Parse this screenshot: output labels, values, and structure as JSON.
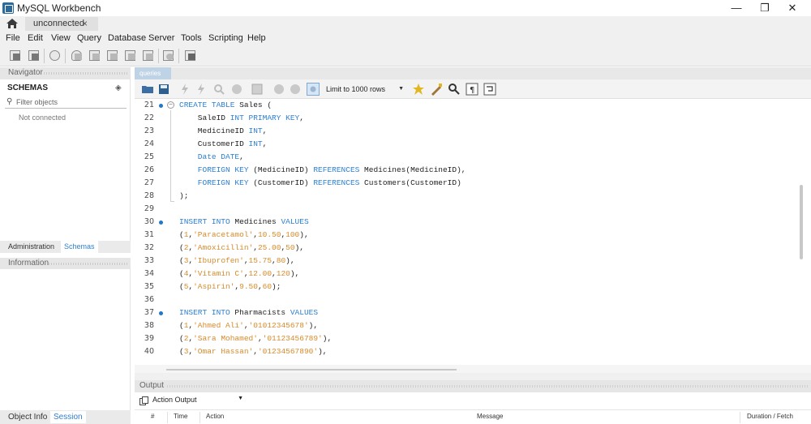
{
  "window": {
    "title": "MySQL Workbench",
    "minimize": "—",
    "maximize": "❐",
    "close": "✕"
  },
  "connection_tab": {
    "label": "unconnected",
    "close": "×"
  },
  "menu": [
    "File",
    "Edit",
    "View",
    "Query",
    "Database",
    "Server",
    "Tools",
    "Scripting",
    "Help"
  ],
  "navigator": {
    "header": "Navigator",
    "schemas_title": "SCHEMAS",
    "filter_placeholder": "Filter objects",
    "not_connected": "Not connected",
    "tabs": [
      "Administration",
      "Schemas"
    ],
    "active_tab": "Schemas"
  },
  "information": {
    "header": "Information",
    "tabs": [
      "Object Info",
      "Session"
    ],
    "active_tab": "Session"
  },
  "query_tab": {
    "label": "queries"
  },
  "query_toolbar": {
    "limit_label": "Limit to 1000 rows"
  },
  "editor": {
    "lines": [
      {
        "n": "21",
        "dot": true,
        "fold": "open",
        "tokens": [
          [
            "kw",
            "CREATE TABLE"
          ],
          [
            "t",
            " Sales ("
          ]
        ]
      },
      {
        "n": "22",
        "tokens": [
          [
            "t",
            "    SaleID "
          ],
          [
            "kw",
            "INT PRIMARY KEY"
          ],
          [
            "t",
            ","
          ]
        ]
      },
      {
        "n": "23",
        "tokens": [
          [
            "t",
            "    MedicineID "
          ],
          [
            "kw",
            "INT"
          ],
          [
            "t",
            ","
          ]
        ]
      },
      {
        "n": "24",
        "tokens": [
          [
            "t",
            "    CustomerID "
          ],
          [
            "kw",
            "INT"
          ],
          [
            "t",
            ","
          ]
        ]
      },
      {
        "n": "25",
        "tokens": [
          [
            "kw",
            "    Date DATE"
          ],
          [
            "t",
            ","
          ]
        ]
      },
      {
        "n": "26",
        "tokens": [
          [
            "kw",
            "    FOREIGN KEY"
          ],
          [
            "t",
            " (MedicineID) "
          ],
          [
            "kw",
            "REFERENCES"
          ],
          [
            "t",
            " Medicines(MedicineID),"
          ]
        ]
      },
      {
        "n": "27",
        "tokens": [
          [
            "kw",
            "    FOREIGN KEY"
          ],
          [
            "t",
            " (CustomerID) "
          ],
          [
            "kw",
            "REFERENCES"
          ],
          [
            "t",
            " Customers(CustomerID)"
          ]
        ]
      },
      {
        "n": "28",
        "tokens": [
          [
            "t",
            ");"
          ]
        ]
      },
      {
        "n": "29",
        "tokens": []
      },
      {
        "n": "30",
        "dot": true,
        "tokens": [
          [
            "kw",
            "INSERT INTO"
          ],
          [
            "t",
            " Medicines "
          ],
          [
            "kw",
            "VALUES"
          ]
        ]
      },
      {
        "n": "31",
        "tokens": [
          [
            "t",
            "("
          ],
          [
            "num",
            "1"
          ],
          [
            "t",
            ","
          ],
          [
            "str",
            "'Paracetamol'"
          ],
          [
            "t",
            ","
          ],
          [
            "num",
            "10.50"
          ],
          [
            "t",
            ","
          ],
          [
            "num",
            "100"
          ],
          [
            "t",
            "),"
          ]
        ]
      },
      {
        "n": "32",
        "tokens": [
          [
            "t",
            "("
          ],
          [
            "num",
            "2"
          ],
          [
            "t",
            ","
          ],
          [
            "str",
            "'Amoxicillin'"
          ],
          [
            "t",
            ","
          ],
          [
            "num",
            "25.00"
          ],
          [
            "t",
            ","
          ],
          [
            "num",
            "50"
          ],
          [
            "t",
            "),"
          ]
        ]
      },
      {
        "n": "33",
        "tokens": [
          [
            "t",
            "("
          ],
          [
            "num",
            "3"
          ],
          [
            "t",
            ","
          ],
          [
            "str",
            "'Ibuprofen'"
          ],
          [
            "t",
            ","
          ],
          [
            "num",
            "15.75"
          ],
          [
            "t",
            ","
          ],
          [
            "num",
            "80"
          ],
          [
            "t",
            "),"
          ]
        ]
      },
      {
        "n": "34",
        "tokens": [
          [
            "t",
            "("
          ],
          [
            "num",
            "4"
          ],
          [
            "t",
            ","
          ],
          [
            "str",
            "'Vitamin C'"
          ],
          [
            "t",
            ","
          ],
          [
            "num",
            "12.00"
          ],
          [
            "t",
            ","
          ],
          [
            "num",
            "120"
          ],
          [
            "t",
            "),"
          ]
        ]
      },
      {
        "n": "35",
        "tokens": [
          [
            "t",
            "("
          ],
          [
            "num",
            "5"
          ],
          [
            "t",
            ","
          ],
          [
            "str",
            "'Aspirin'"
          ],
          [
            "t",
            ","
          ],
          [
            "num",
            "9.50"
          ],
          [
            "t",
            ","
          ],
          [
            "num",
            "60"
          ],
          [
            "t",
            ");"
          ]
        ]
      },
      {
        "n": "36",
        "tokens": []
      },
      {
        "n": "37",
        "dot": true,
        "tokens": [
          [
            "kw",
            "INSERT INTO"
          ],
          [
            "t",
            " Pharmacists "
          ],
          [
            "kw",
            "VALUES"
          ]
        ]
      },
      {
        "n": "38",
        "tokens": [
          [
            "t",
            "("
          ],
          [
            "num",
            "1"
          ],
          [
            "t",
            ","
          ],
          [
            "str",
            "'Ahmed Ali'"
          ],
          [
            "t",
            ","
          ],
          [
            "str",
            "'01012345678'"
          ],
          [
            "t",
            "),"
          ]
        ]
      },
      {
        "n": "39",
        "tokens": [
          [
            "t",
            "("
          ],
          [
            "num",
            "2"
          ],
          [
            "t",
            ","
          ],
          [
            "str",
            "'Sara Mohamed'"
          ],
          [
            "t",
            ","
          ],
          [
            "str",
            "'01123456789'"
          ],
          [
            "t",
            "),"
          ]
        ]
      },
      {
        "n": "40",
        "tokens": [
          [
            "t",
            "("
          ],
          [
            "num",
            "3"
          ],
          [
            "t",
            ","
          ],
          [
            "str",
            "'Omar Hassan'"
          ],
          [
            "t",
            ","
          ],
          [
            "str",
            "'01234567890'"
          ],
          [
            "t",
            "),"
          ]
        ]
      }
    ]
  },
  "output": {
    "header": "Output",
    "select_value": "Action Output",
    "columns": [
      "#",
      "Time",
      "Action",
      "Message",
      "Duration / Fetch"
    ]
  },
  "colors": {
    "keyword": "#2f7fd0",
    "string": "#d78a2a",
    "accent": "#1f77c9"
  }
}
